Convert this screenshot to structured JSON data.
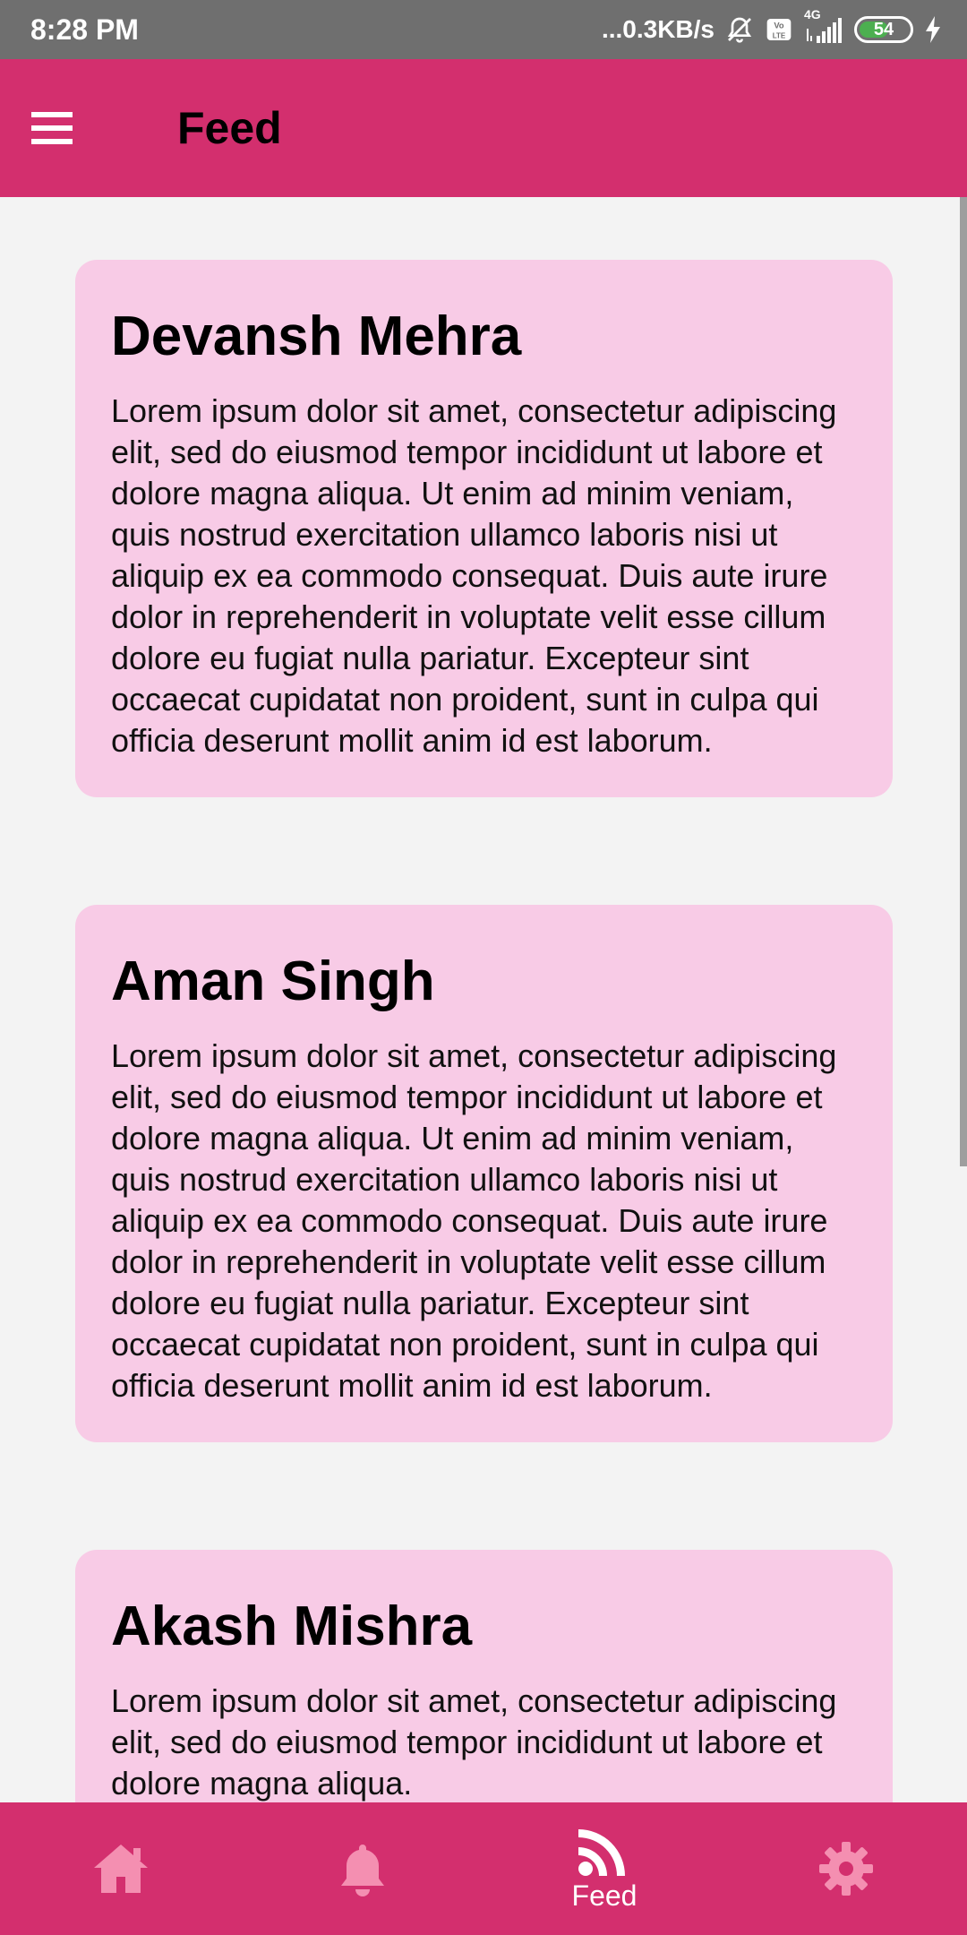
{
  "status_bar": {
    "time": "8:28 PM",
    "network_speed": "...0.3KB/s",
    "network_type": "4G",
    "battery_level": "54",
    "icons": [
      "dnd-bell-icon",
      "volte-icon",
      "signal-icon",
      "battery-icon",
      "charging-icon"
    ]
  },
  "app_bar": {
    "title": "Feed",
    "menu_icon": "hamburger-menu-icon"
  },
  "colors": {
    "primary": "#d32f6e",
    "card_background": "#f8cbe6",
    "nav_icon_inactive": "#f48fb1",
    "nav_icon_active": "#ffffff",
    "page_background": "#f3f3f3"
  },
  "feed": {
    "posts": [
      {
        "name": "Devansh Mehra",
        "text": "Lorem ipsum dolor sit amet, consectetur adipiscing elit, sed do eiusmod tempor incididunt ut labore et dolore magna aliqua. Ut enim ad minim veniam, quis nostrud exercitation ullamco laboris nisi ut aliquip ex ea commodo consequat. Duis aute irure dolor in reprehenderit in voluptate velit esse cillum dolore eu fugiat nulla pariatur. Excepteur sint occaecat cupidatat non proident, sunt in culpa qui officia deserunt mollit anim id est laborum."
      },
      {
        "name": "Aman Singh",
        "text": "Lorem ipsum dolor sit amet, consectetur adipiscing elit, sed do eiusmod tempor incididunt ut labore et dolore magna aliqua. Ut enim ad minim veniam, quis nostrud exercitation ullamco laboris nisi ut aliquip ex ea commodo consequat. Duis aute irure dolor in reprehenderit in voluptate velit esse cillum dolore eu fugiat nulla pariatur. Excepteur sint occaecat cupidatat non proident, sunt in culpa qui officia deserunt mollit anim id est laborum."
      },
      {
        "name": "Akash Mishra",
        "text": "Lorem ipsum dolor sit amet, consectetur adipiscing elit, sed do eiusmod tempor incididunt ut labore et dolore magna aliqua."
      }
    ]
  },
  "bottom_nav": {
    "items": [
      {
        "icon": "home-icon",
        "label": "",
        "active": false
      },
      {
        "icon": "bell-icon",
        "label": "",
        "active": false
      },
      {
        "icon": "rss-feed-icon",
        "label": "Feed",
        "active": true
      },
      {
        "icon": "gear-icon",
        "label": "",
        "active": false
      }
    ]
  }
}
